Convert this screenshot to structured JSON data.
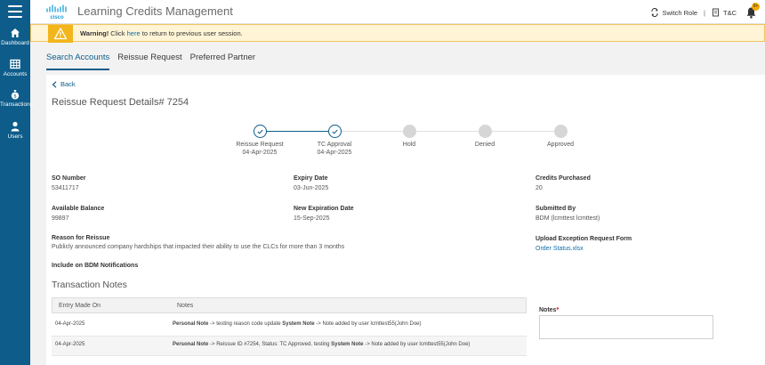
{
  "sidebar": {
    "items": [
      {
        "label": "Dashboard",
        "icon": "home-icon"
      },
      {
        "label": "Accounts",
        "icon": "grid-icon"
      },
      {
        "label": "Transactions",
        "icon": "money-bag-icon"
      },
      {
        "label": "Users",
        "icon": "user-icon"
      }
    ]
  },
  "header": {
    "title": "Learning Credits Management",
    "switch_role": "Switch Role",
    "separator": "|",
    "tc": "T&C",
    "notification_count": "9+"
  },
  "warning": {
    "bold": "Warning!",
    "pre": " Click ",
    "link": "here",
    "post": " to return to previous user session."
  },
  "tabs": [
    {
      "label": "Search Accounts",
      "active": true
    },
    {
      "label": "Reissue Request",
      "active": false
    },
    {
      "label": "Preferred Partner",
      "active": false
    }
  ],
  "details": {
    "back": "Back",
    "title": "Reissue Request Details# 7254",
    "steps": [
      {
        "label": "Reissue Request",
        "date": "04-Apr-2025",
        "status": "done"
      },
      {
        "label": "TC Approval",
        "date": "04-Apr-2025",
        "status": "done"
      },
      {
        "label": "Hold",
        "date": "",
        "status": "pending"
      },
      {
        "label": "Denied",
        "date": "",
        "status": "pending"
      },
      {
        "label": "Approved",
        "date": "",
        "status": "pending"
      }
    ],
    "so_number": {
      "label": "SO Number",
      "value": "53411717"
    },
    "expiry_date": {
      "label": "Expiry Date",
      "value": "03-Jun-2025"
    },
    "credits_purchased": {
      "label": "Credits Purchased",
      "value": "20"
    },
    "available_balance": {
      "label": "Available Balance",
      "value": "99897"
    },
    "new_expiration_date": {
      "label": "New Expiration Date",
      "value": "15-Sep-2025"
    },
    "submitted_by": {
      "label": "Submitted By",
      "value": "BDM (lcmttest lcmttest)"
    },
    "reason": {
      "label": "Reason for Reissue",
      "value": "Publicly announced company hardships that impacted their ability to use the CLCs for more than 3 months"
    },
    "upload": {
      "label": "Upload Exception Request Form",
      "value": "Order Status.xlsx"
    },
    "bdm_notifications": {
      "label": "Include on BDM Notifications"
    }
  },
  "transaction_notes": {
    "title": "Transaction Notes",
    "columns": [
      "Entry Made On",
      "Notes"
    ],
    "rows": [
      {
        "date": "04-Apr-2025",
        "p1b": "Personal Note",
        "p1": " -> testing reason code update ",
        "p2b": "System Note",
        "p2": " -> Note added by user lcmttest55(John Doe)"
      },
      {
        "date": "04-Apr-2025",
        "p1b": "Personal Note",
        "p1": " -> Reissue ID #7254, Status: TC Approved. testing ",
        "p2b": "System Note",
        "p2": " -> Note added by user lcmttest55(John Doe)"
      }
    ],
    "notes_label": "Notes",
    "required_mark": "*"
  },
  "colors": {
    "sidebar": "#0d5c8a",
    "accent": "#0d5c8a",
    "warning_bg": "#fff4d6",
    "warning_icon_bg": "#f2b51c",
    "badge": "#f2a900"
  }
}
